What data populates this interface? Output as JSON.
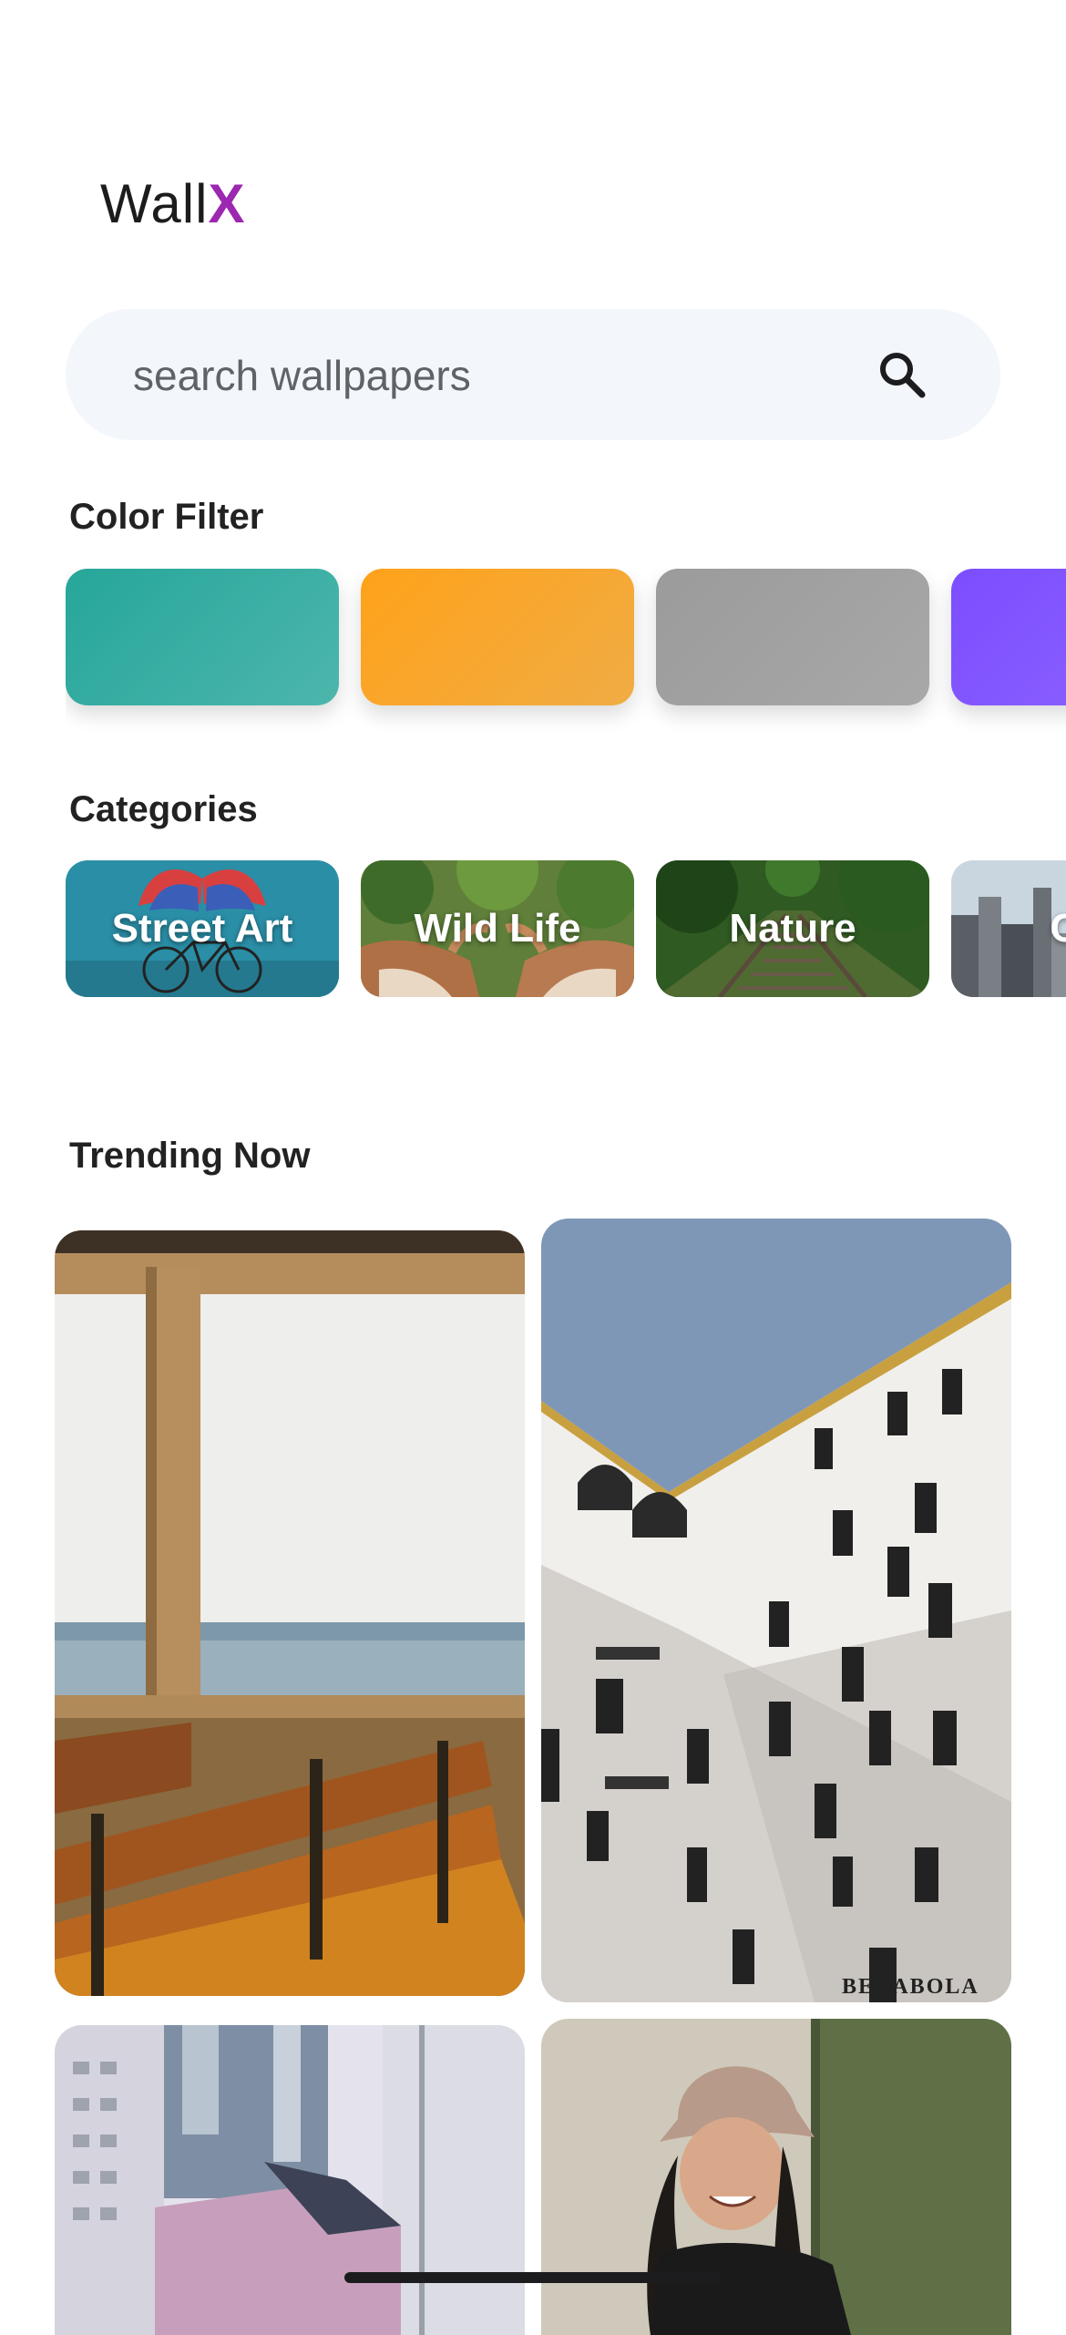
{
  "app": {
    "title_main": "Wall",
    "title_accent": "X",
    "accent_color": "#9c27b0"
  },
  "search": {
    "placeholder": "search wallpapers",
    "value": "",
    "icon": "search-icon"
  },
  "color_filter": {
    "heading": "Color Filter",
    "swatches": [
      {
        "name": "teal",
        "color": "#26a69a"
      },
      {
        "name": "orange",
        "color": "#ffa726"
      },
      {
        "name": "grey",
        "color": "#9e9e9e"
      },
      {
        "name": "purple",
        "color": "#7c4dff"
      }
    ]
  },
  "categories": {
    "heading": "Categories",
    "items": [
      {
        "label": "Street Art"
      },
      {
        "label": "Wild Life"
      },
      {
        "label": "Nature"
      },
      {
        "label": "City"
      }
    ]
  },
  "trending": {
    "heading": "Trending Now",
    "items": [
      {
        "name": "boat-window-bench"
      },
      {
        "name": "white-building",
        "sign_text": "BENABOLA"
      },
      {
        "name": "city-buildings"
      },
      {
        "name": "woman-bucket-hat"
      }
    ]
  }
}
